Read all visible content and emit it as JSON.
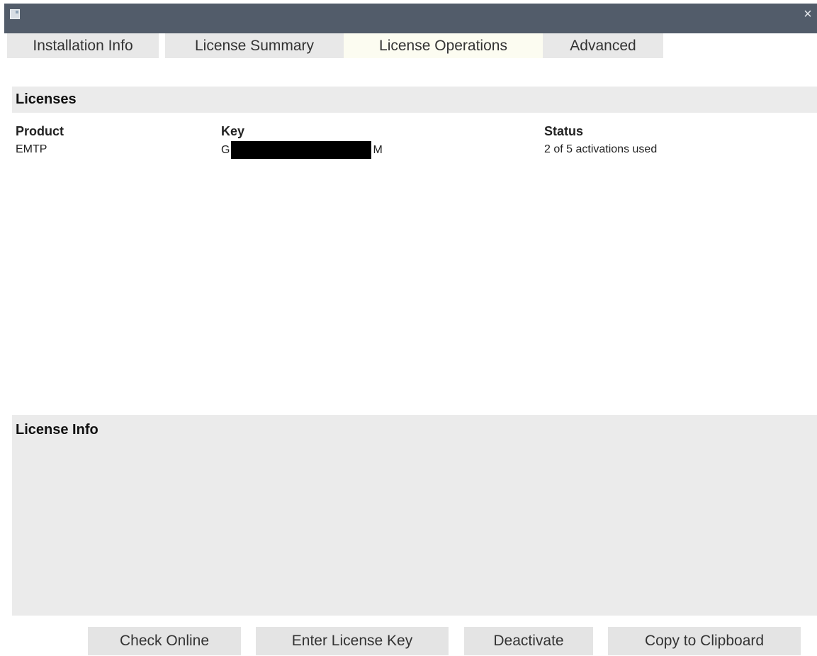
{
  "window": {
    "icon": "app-window-icon",
    "close_icon": "close-icon"
  },
  "tabs": [
    {
      "label": "Installation Info",
      "active": false
    },
    {
      "label": "License Summary",
      "active": false
    },
    {
      "label": "License Operations",
      "active": true
    },
    {
      "label": "Advanced",
      "active": false
    }
  ],
  "licenses": {
    "header": "Licenses",
    "columns": [
      "Product",
      "Key",
      "Status"
    ],
    "rows": [
      {
        "product": "EMTP",
        "key_prefix": "G",
        "key_suffix": "M",
        "status": "2 of 5 activations used"
      }
    ]
  },
  "license_info": {
    "title": "License Info"
  },
  "buttons": {
    "check_online": "Check Online",
    "enter_key": "Enter License Key",
    "deactivate": "Deactivate",
    "copy": "Copy to Clipboard"
  },
  "colors": {
    "titlebar": "#525c6a",
    "tab_bg": "#e8e8e8",
    "tab_active_bg": "#fcfcf1",
    "panel_bg": "#ebebeb"
  }
}
